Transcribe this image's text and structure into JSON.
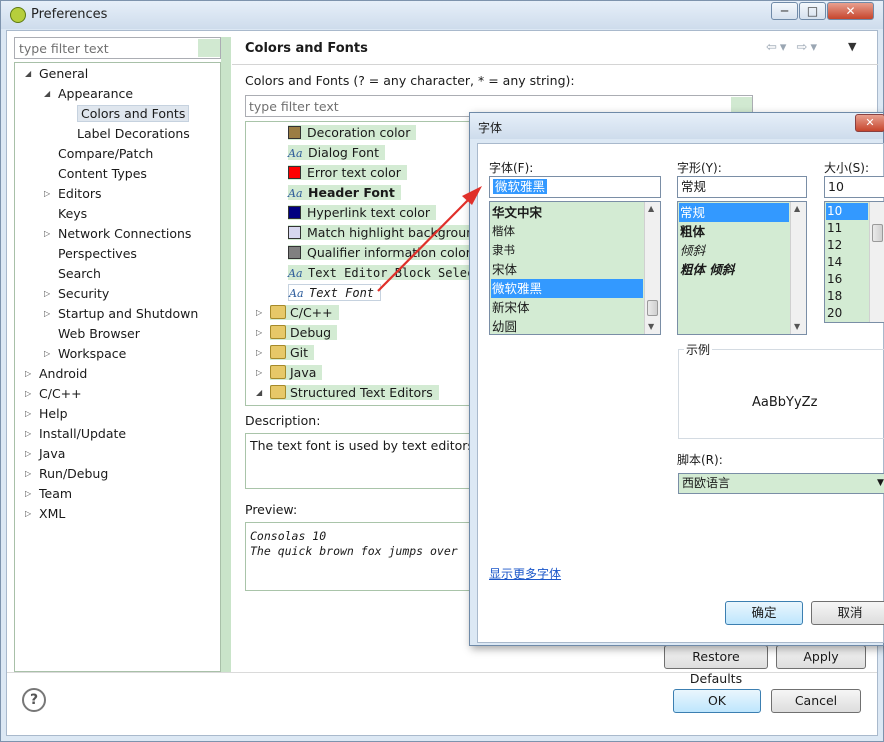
{
  "window": {
    "title": "Preferences"
  },
  "left": {
    "filter_placeholder": "type filter text",
    "tree": [
      {
        "label": "General",
        "indent": 0,
        "expander": "open"
      },
      {
        "label": "Appearance",
        "indent": 1,
        "expander": "open"
      },
      {
        "label": "Colors and Fonts",
        "indent": 2,
        "expander": "none",
        "selected": true
      },
      {
        "label": "Label Decorations",
        "indent": 2,
        "expander": "none"
      },
      {
        "label": "Compare/Patch",
        "indent": 1,
        "expander": "none"
      },
      {
        "label": "Content Types",
        "indent": 1,
        "expander": "none"
      },
      {
        "label": "Editors",
        "indent": 1,
        "expander": "closed"
      },
      {
        "label": "Keys",
        "indent": 1,
        "expander": "none"
      },
      {
        "label": "Network Connections",
        "indent": 1,
        "expander": "closed"
      },
      {
        "label": "Perspectives",
        "indent": 1,
        "expander": "none"
      },
      {
        "label": "Search",
        "indent": 1,
        "expander": "none"
      },
      {
        "label": "Security",
        "indent": 1,
        "expander": "closed"
      },
      {
        "label": "Startup and Shutdown",
        "indent": 1,
        "expander": "closed"
      },
      {
        "label": "Web Browser",
        "indent": 1,
        "expander": "none"
      },
      {
        "label": "Workspace",
        "indent": 1,
        "expander": "closed"
      },
      {
        "label": "Android",
        "indent": 0,
        "expander": "closed"
      },
      {
        "label": "C/C++",
        "indent": 0,
        "expander": "closed"
      },
      {
        "label": "Help",
        "indent": 0,
        "expander": "closed"
      },
      {
        "label": "Install/Update",
        "indent": 0,
        "expander": "closed"
      },
      {
        "label": "Java",
        "indent": 0,
        "expander": "closed"
      },
      {
        "label": "Run/Debug",
        "indent": 0,
        "expander": "closed"
      },
      {
        "label": "Team",
        "indent": 0,
        "expander": "closed"
      },
      {
        "label": "XML",
        "indent": 0,
        "expander": "closed"
      }
    ]
  },
  "page": {
    "title": "Colors and Fonts",
    "hint_label": "Colors and Fonts (? = any character, * = any string):",
    "filter_placeholder": "type filter text",
    "items": [
      {
        "label": "Decoration color",
        "kind": "swatch",
        "color": "#9b7d43"
      },
      {
        "label": "Dialog Font",
        "kind": "font"
      },
      {
        "label": "Error text color",
        "kind": "swatch",
        "color": "#ff0000"
      },
      {
        "label": "Header Font",
        "kind": "font",
        "bold": true
      },
      {
        "label": "Hyperlink text color",
        "kind": "swatch",
        "color": "#000080"
      },
      {
        "label": "Match highlight background",
        "kind": "swatch",
        "color": "#d7d7ef"
      },
      {
        "label": "Qualifier information color",
        "kind": "swatch",
        "color": "#808080"
      },
      {
        "label": "Text Editor Block Selection Font",
        "kind": "font",
        "mono": true
      },
      {
        "label": "Text Font",
        "kind": "font",
        "mono": true,
        "italic": true,
        "selected": true
      }
    ],
    "categories": [
      {
        "label": "C/C++",
        "expander": "closed"
      },
      {
        "label": "Debug",
        "expander": "closed"
      },
      {
        "label": "Git",
        "expander": "closed"
      },
      {
        "label": "Java",
        "expander": "closed"
      },
      {
        "label": "Structured Text Editors",
        "expander": "open"
      }
    ],
    "description_label": "Description:",
    "description_text": "The text font is used by text editors.",
    "preview_label": "Preview:",
    "preview_lines": [
      "Consolas 10",
      "The quick brown fox jumps over"
    ],
    "restore_label": "Restore Defaults",
    "apply_label": "Apply"
  },
  "footer": {
    "ok_label": "OK",
    "cancel_label": "Cancel",
    "help_glyph": "?"
  },
  "font_dialog": {
    "title": "字体",
    "font_label": "字体(F):",
    "style_label": "字形(Y):",
    "size_label": "大小(S):",
    "font_value": "微软雅黑",
    "style_value": "常规",
    "size_value": "10",
    "fonts": [
      "华文中宋",
      "楷体",
      "隶书",
      "宋体",
      "微软雅黑",
      "新宋体",
      "幼圆"
    ],
    "font_selected_index": 4,
    "styles": [
      "常规",
      "粗体",
      "倾斜",
      "粗体 倾斜"
    ],
    "style_selected_index": 0,
    "sizes": [
      "10",
      "11",
      "12",
      "14",
      "16",
      "18",
      "20"
    ],
    "size_selected_index": 0,
    "sample_label": "示例",
    "sample_text": "AaBbYyZz",
    "script_label": "脚本(R):",
    "script_value": "西欧语言",
    "more_fonts_link": "显示更多字体",
    "ok_label": "确定",
    "cancel_label": "取消"
  },
  "colors": {
    "accent_green": "#d3ebd3",
    "selection_blue": "#3399ff",
    "arrow_red": "#e0302a"
  }
}
